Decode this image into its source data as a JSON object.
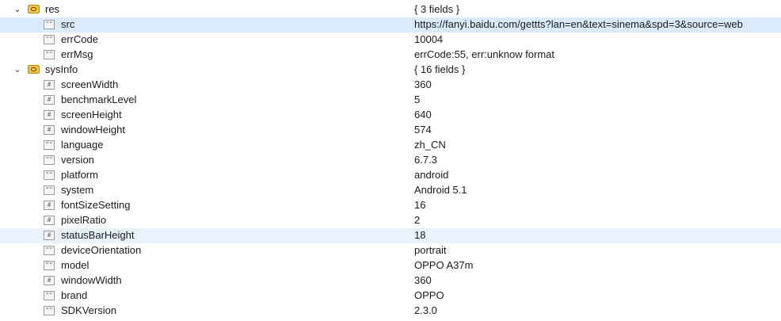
{
  "tree": {
    "res": {
      "key": "res",
      "summary": "{ 3 fields }",
      "items": [
        {
          "key": "src",
          "value": "https://fanyi.baidu.com/gettts?lan=en&text=sinema&spd=3&source=web",
          "type_glyph": "\"\""
        },
        {
          "key": "errCode",
          "value": "10004",
          "type_glyph": "\"\""
        },
        {
          "key": "errMsg",
          "value": "errCode:55, err:unknow format",
          "type_glyph": "\"\""
        }
      ]
    },
    "sysInfo": {
      "key": "sysInfo",
      "summary": "{ 16 fields }",
      "items": [
        {
          "key": "screenWidth",
          "value": "360",
          "type_glyph": "#"
        },
        {
          "key": "benchmarkLevel",
          "value": "5",
          "type_glyph": "#"
        },
        {
          "key": "screenHeight",
          "value": "640",
          "type_glyph": "#"
        },
        {
          "key": "windowHeight",
          "value": "574",
          "type_glyph": "#"
        },
        {
          "key": "language",
          "value": "zh_CN",
          "type_glyph": "\"\""
        },
        {
          "key": "version",
          "value": "6.7.3",
          "type_glyph": "\"\""
        },
        {
          "key": "platform",
          "value": "android",
          "type_glyph": "\"\""
        },
        {
          "key": "system",
          "value": "Android 5.1",
          "type_glyph": "\"\""
        },
        {
          "key": "fontSizeSetting",
          "value": "16",
          "type_glyph": "#"
        },
        {
          "key": "pixelRatio",
          "value": "2",
          "type_glyph": "#"
        },
        {
          "key": "statusBarHeight",
          "value": "18",
          "type_glyph": "#"
        },
        {
          "key": "deviceOrientation",
          "value": "portrait",
          "type_glyph": "\"\""
        },
        {
          "key": "model",
          "value": "OPPO A37m",
          "type_glyph": "\"\""
        },
        {
          "key": "windowWidth",
          "value": "360",
          "type_glyph": "#"
        },
        {
          "key": "brand",
          "value": "OPPO",
          "type_glyph": "\"\""
        },
        {
          "key": "SDKVersion",
          "value": "2.3.0",
          "type_glyph": "\"\""
        }
      ]
    }
  },
  "icons": {
    "expand": "chevron-down-icon",
    "object": "object-icon",
    "string": "string-icon",
    "number": "number-icon"
  },
  "colors": {
    "selection": "#d9ebfc",
    "hover": "#eaf3fd",
    "object_icon": "#f4c542"
  }
}
